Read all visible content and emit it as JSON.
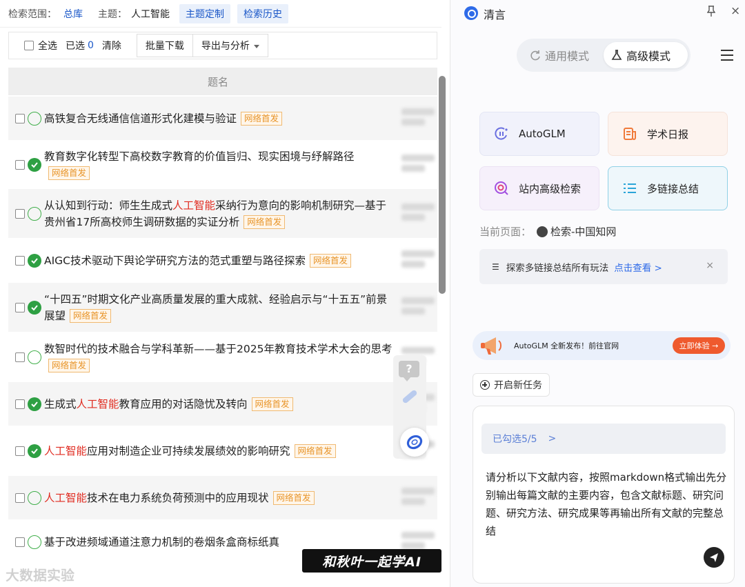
{
  "left": {
    "topbar": {
      "scope_label": "检索范围：",
      "scope_value": "总库",
      "theme_label": "主题：",
      "theme_value": "人工智能",
      "custom_theme": "主题定制",
      "history": "检索历史"
    },
    "toolbar": {
      "select_all": "全选",
      "selected_label": "已选",
      "selected_count": "0",
      "clear": "清除",
      "batch_download": "批量下载",
      "export_analyze": "导出与分析"
    },
    "table": {
      "header": "题名",
      "badge": "网络首发",
      "rows": [
        {
          "pre": "高铁复合无线通信信道形式化建模与验证",
          "hl": "",
          "post": "",
          "status": "empty"
        },
        {
          "pre": "教育数字化转型下高校数字教育的价值旨归、现实困境与纾解路径",
          "hl": "",
          "post": "",
          "status": "done"
        },
        {
          "pre": "从认知到行动：师生生成式",
          "hl": "人工智能",
          "post": "采纳行为意向的影响机制研究—基于贵州省17所高校师生调研数据的实证分析",
          "status": "empty"
        },
        {
          "pre": "AIGC技术驱动下舆论学研究方法的范式重塑与路径探索",
          "hl": "",
          "post": "",
          "status": "done"
        },
        {
          "pre": "“十四五”时期文化产业高质量发展的重大成就、经验启示与“十五五”前景展望",
          "hl": "",
          "post": "",
          "status": "done"
        },
        {
          "pre": "数智时代的技术融合与学科革新——基于2025年教育技术学术大会的思考",
          "hl": "",
          "post": "",
          "status": "empty"
        },
        {
          "pre": "生成式",
          "hl": "人工智能",
          "post": "教育应用的对话隐忧及转向",
          "status": "done"
        },
        {
          "pre": "",
          "hl": "人工智能",
          "post": "应用对制造企业可持续发展绩效的影响研究",
          "status": "done"
        },
        {
          "pre": "",
          "hl": "人工智能",
          "post": "技术在电力系统负荷预测中的应用现状",
          "status": "empty"
        },
        {
          "pre": "基于改进频域通道注意力机制的卷烟条盒商标纸真",
          "hl": "",
          "post": "",
          "status": "empty"
        }
      ]
    },
    "watermark_badge": "和秋叶一起学AI",
    "watermark_text": "大数据实验"
  },
  "right": {
    "app_name": "清言",
    "pin_icon": "pin-icon",
    "close_symbol": "×",
    "modes": {
      "general": "通用模式",
      "advanced": "高级模式"
    },
    "cards": [
      {
        "label": "AutoGLM",
        "icon": "autoglm-icon",
        "color": "#6a6fe0"
      },
      {
        "label": "学术日报",
        "icon": "report-icon",
        "color": "#f07a3a"
      },
      {
        "label": "站内高级检索",
        "icon": "search-icon",
        "color": "#a24fe0"
      },
      {
        "label": "多链接总结",
        "icon": "list-icon",
        "color": "#2aa5d8"
      }
    ],
    "current_page_label": "当前页面：",
    "current_page_value": "检索-中国知网",
    "tip": {
      "text": "探索多链接总结所有玩法",
      "more": "点击查看 >",
      "close": "×"
    },
    "banner": {
      "text": "AutoGLM 全新发布！前往官网",
      "cta": "立即体验 →"
    },
    "new_task": "开启新任务",
    "input": {
      "selected": "已勾选5/5",
      "selected_arrow": ">",
      "prompt": "请分析以下文献内容，按照markdown格式输出先分别输出每篇文献的主要内容，包含文献标题、研究问题、研究方法、研究成果等再输出所有文献的完整总结"
    }
  }
}
